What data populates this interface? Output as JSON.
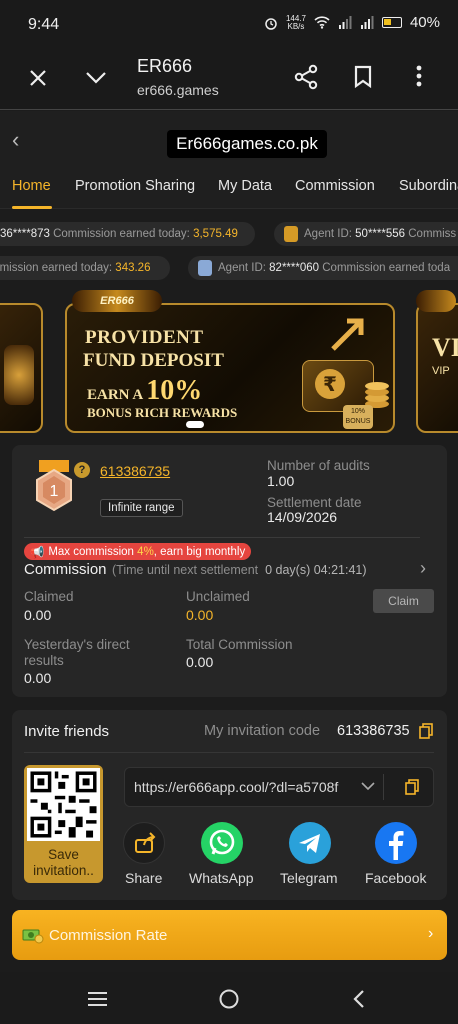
{
  "status_bar": {
    "time": "9:44",
    "speed": "144.7\nKB/s",
    "battery": "40%"
  },
  "browser": {
    "title": "ER666",
    "url": "er666.games"
  },
  "site": {
    "title": "Er666games.co.pk"
  },
  "tabs": [
    "Home",
    "Promotion Sharing",
    "My Data",
    "Commission",
    "Subordina"
  ],
  "tickers": [
    {
      "text_a": "36****873",
      "text_b": "Commission earned today:",
      "amount": "3,575.49"
    },
    {
      "text_a": "Agent ID:",
      "text_b": "50****556",
      "text_c": "Commiss"
    },
    {
      "text_a": "mmission earned today:",
      "amount": "343.26"
    },
    {
      "text_a": "Agent ID:",
      "text_b": "82****060",
      "text_c": "Commission earned toda"
    }
  ],
  "banner": {
    "logo": "ER666",
    "line1": "PROVIDENT",
    "line2": "FUND DEPOSIT",
    "line3_prefix": "EARN A",
    "line3_pct": "10%",
    "line4": "BONUS RICH REWARDS",
    "chip": "10%\nBONUS",
    "wallet_label": "PROVIDENT FUND DEPOSIT",
    "side_right_text": "VI",
    "side_right_sub": "VIP"
  },
  "agent": {
    "level": "1",
    "id": "613386735",
    "range": "Infinite range",
    "audits_label": "Number of audits",
    "audits_value": "1.00",
    "settlement_label": "Settlement date",
    "settlement_value": "14/09/2026",
    "max_badge_prefix": "Max commission",
    "max_badge_pct": "4%",
    "max_badge_suffix": ", earn big monthly",
    "commission_title": "Commission",
    "commission_sub_prefix": "(Time until next settlement",
    "commission_sub_time": "0 day(s) 04:21:41)",
    "claimed_label": "Claimed",
    "claimed_value": "0.00",
    "unclaimed_label": "Unclaimed",
    "unclaimed_value": "0.00",
    "claim_button": "Claim",
    "yesterday_label": "Yesterday's direct results",
    "yesterday_value": "0.00",
    "total_label": "Total Commission",
    "total_value": "0.00"
  },
  "invite": {
    "title": "Invite friends",
    "code_label": "My invitation code",
    "code": "613386735",
    "link": "https://er666app.cool/?dl=a5708f",
    "qr_save": "Save invitation..",
    "share": [
      {
        "label": "Share",
        "color": "#2a2a2a"
      },
      {
        "label": "WhatsApp",
        "color": "#25d366"
      },
      {
        "label": "Telegram",
        "color": "#2aa1da"
      },
      {
        "label": "Facebook",
        "color": "#1877f2"
      }
    ]
  },
  "rate": {
    "label": "Commission Rate"
  }
}
